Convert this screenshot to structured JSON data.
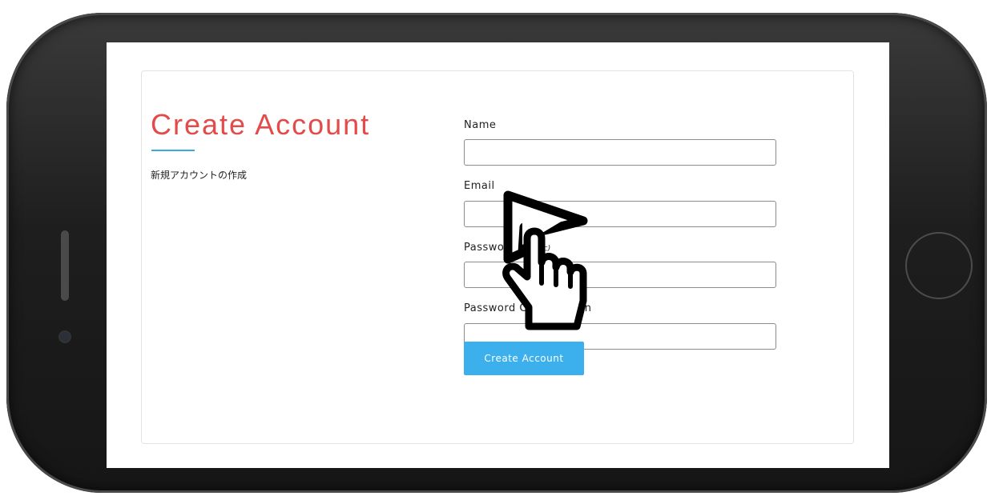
{
  "page": {
    "title": "Create Account",
    "subtitle": "新規アカウントの作成"
  },
  "form": {
    "fields": [
      {
        "label": "Name",
        "value": "",
        "placeholder": ""
      },
      {
        "label": "Email",
        "value": "",
        "placeholder": ""
      },
      {
        "label": "Password",
        "note": "文字以上)",
        "value": "",
        "placeholder": ""
      },
      {
        "label": "Password Confirmation",
        "value": "",
        "placeholder": ""
      }
    ],
    "submit_label": "Create Account"
  },
  "icons": {
    "cursor": "hand-pointer-icon",
    "phone_home_button": "home-button",
    "phone_camera": "camera-icon"
  },
  "colors": {
    "title": "#e34a4a",
    "underline": "#3aa9e0",
    "button": "#3cb0ec",
    "button_text": "#ffffff"
  }
}
